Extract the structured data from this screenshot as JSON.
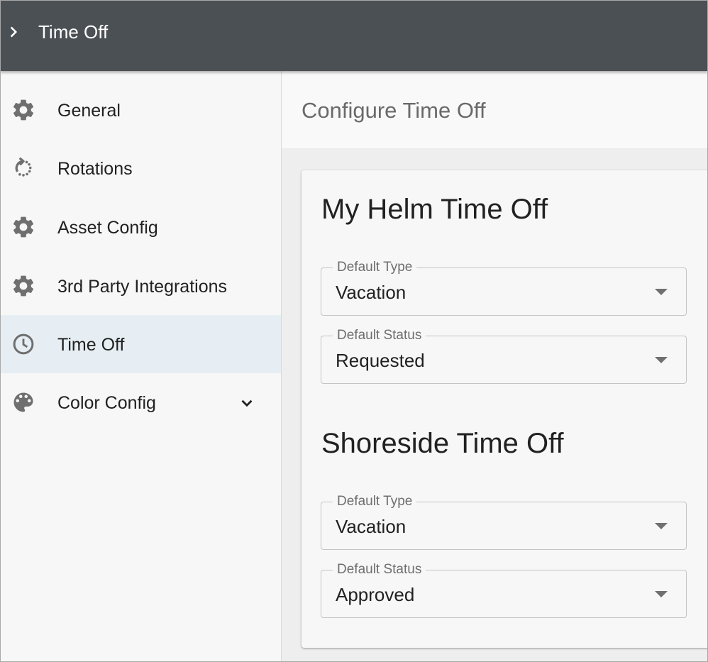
{
  "appbar": {
    "title": "Time Off",
    "toggle_icon": "chevron-right-icon"
  },
  "sidebar": {
    "items": [
      {
        "label": "General",
        "icon": "gear-icon"
      },
      {
        "label": "Rotations",
        "icon": "rotate-icon"
      },
      {
        "label": "Asset Config",
        "icon": "gear-icon"
      },
      {
        "label": "3rd Party Integrations",
        "icon": "gear-icon"
      },
      {
        "label": "Time Off",
        "icon": "clock-icon",
        "active": true
      },
      {
        "label": "Color Config",
        "icon": "palette-icon",
        "expand_icon": "chevron-down-icon"
      }
    ]
  },
  "main": {
    "page_title": "Configure Time Off",
    "sections": [
      {
        "title": "My Helm Time Off",
        "fields": [
          {
            "label": "Default Type",
            "value": "Vacation"
          },
          {
            "label": "Default Status",
            "value": "Requested"
          }
        ]
      },
      {
        "title": "Shoreside Time Off",
        "fields": [
          {
            "label": "Default Type",
            "value": "Vacation"
          },
          {
            "label": "Default Status",
            "value": "Approved"
          }
        ]
      }
    ]
  },
  "colors": {
    "appbar_bg": "#4b5054",
    "sidebar_bg": "#f7f7f7",
    "active_item_bg": "#e6eef3",
    "icon_gray": "#6f6f6f"
  }
}
